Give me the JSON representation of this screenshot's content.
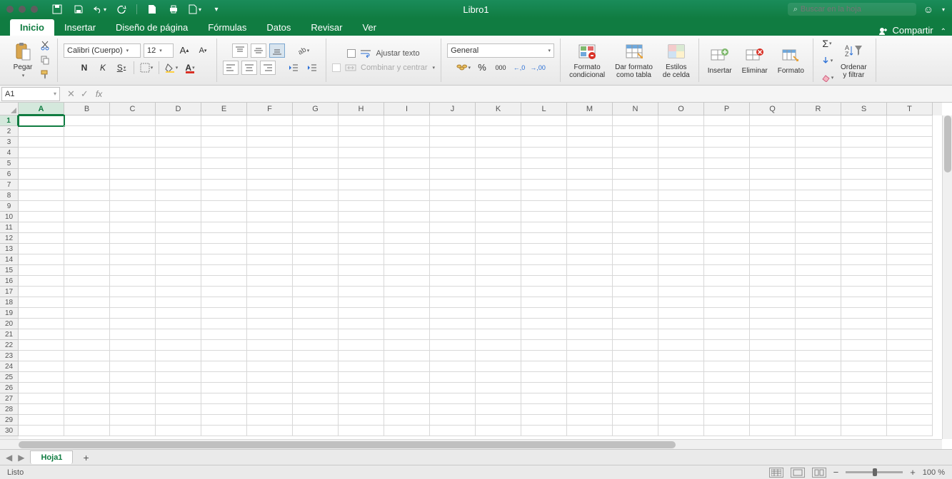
{
  "title": "Libro1",
  "search_placeholder": "Buscar en la hoja",
  "tabs": [
    "Inicio",
    "Insertar",
    "Diseño de página",
    "Fórmulas",
    "Datos",
    "Revisar",
    "Ver"
  ],
  "active_tab": 0,
  "share": "Compartir",
  "ribbon": {
    "paste": "Pegar",
    "font_name": "Calibri (Cuerpo)",
    "font_size": "12",
    "wrap_text": "Ajustar texto",
    "merge_center": "Combinar y centrar",
    "num_format": "General",
    "thousand_sep": "000",
    "decimal_inc": ",0",
    "decimal_dec": ",00",
    "conditional": "Formato\ncondicional",
    "as_table": "Dar formato\ncomo tabla",
    "cell_styles": "Estilos\nde celda",
    "insert": "Insertar",
    "delete": "Eliminar",
    "format": "Formato",
    "sort_filter": "Ordenar\ny filtrar"
  },
  "namebox": "A1",
  "columns": [
    "A",
    "B",
    "C",
    "D",
    "E",
    "F",
    "G",
    "H",
    "I",
    "J",
    "K",
    "L",
    "M",
    "N",
    "O",
    "P",
    "Q",
    "R",
    "S",
    "T"
  ],
  "rows": 30,
  "active_cell": {
    "r": 0,
    "c": 0
  },
  "sheet_tab": "Hoja1",
  "status": "Listo",
  "zoom": "100 %"
}
